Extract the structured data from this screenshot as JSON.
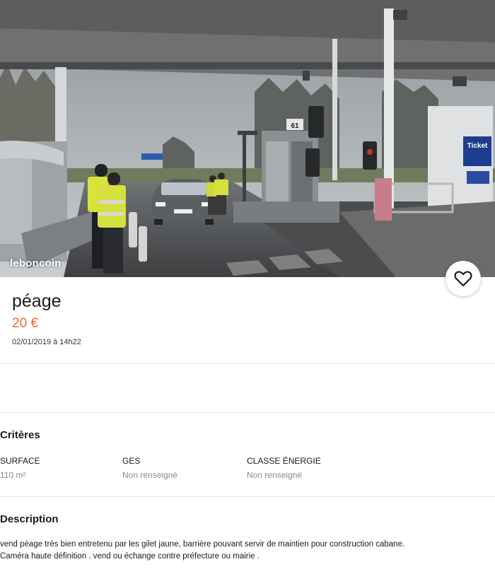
{
  "photo": {
    "watermark": "leboncoin",
    "booth_number": "61",
    "sign_ticket": "Ticket"
  },
  "favorite": {
    "icon": "heart-icon"
  },
  "ad": {
    "title": "péage",
    "price": "20 €",
    "date": "02/01/2019 à 14h22"
  },
  "criteria": {
    "heading": "Critères",
    "items": [
      {
        "label": "SURFACE",
        "value": "110 m²"
      },
      {
        "label": "GES",
        "value": "Non renseigné"
      },
      {
        "label": "CLASSE ÉNERGIE",
        "value": "Non renseigné"
      }
    ]
  },
  "description": {
    "heading": "Description",
    "lines": [
      "vend péage très bien entretenu par les gilet jaune, barrière pouvant servir de maintien pour construction cabane.",
      "Caméra haute définition . vend ou échange contre préfecture ou mairie ."
    ]
  },
  "colors": {
    "price": "#ea6b30",
    "muted": "#8a8a8a"
  }
}
